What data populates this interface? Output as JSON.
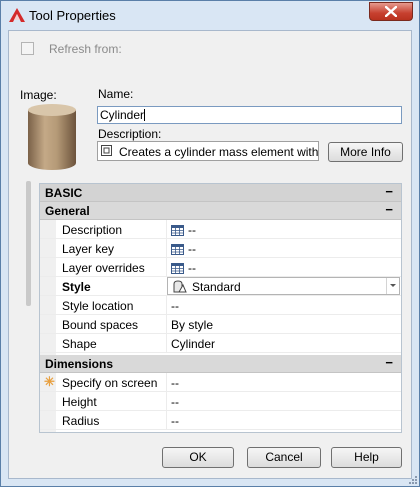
{
  "window": {
    "title": "Tool Properties"
  },
  "refresh": {
    "label": "Refresh from:",
    "checked": false
  },
  "image": {
    "label": "Image:"
  },
  "name": {
    "label": "Name:",
    "value": "Cylinder"
  },
  "description": {
    "label": "Description:",
    "value": "Creates a cylinder mass element with s"
  },
  "buttons": {
    "more_info": "More Info",
    "ok": "OK",
    "cancel": "Cancel",
    "help": "Help"
  },
  "properties": {
    "basic_header": "BASIC",
    "general_header": "General",
    "collapse_glyph": "−",
    "general_rows": [
      {
        "key": "Description",
        "value": "--"
      },
      {
        "key": "Layer key",
        "value": "--"
      },
      {
        "key": "Layer overrides",
        "value": "--"
      },
      {
        "key": "Style",
        "value": "Standard"
      },
      {
        "key": "Style location",
        "value": "--"
      },
      {
        "key": "Bound spaces",
        "value": "By style"
      },
      {
        "key": "Shape",
        "value": "Cylinder"
      }
    ],
    "dimensions_header": "Dimensions",
    "dimension_rows": [
      {
        "key": "Specify on screen",
        "value": "--"
      },
      {
        "key": "Height",
        "value": "--"
      },
      {
        "key": "Radius",
        "value": "--"
      }
    ],
    "required_marker": "✳"
  },
  "colors": {
    "title_bg": "#d9e6f4",
    "close_btn": "#c7402f",
    "header_bg": "#d9d9d9",
    "app_icon": "#d42a2a"
  }
}
